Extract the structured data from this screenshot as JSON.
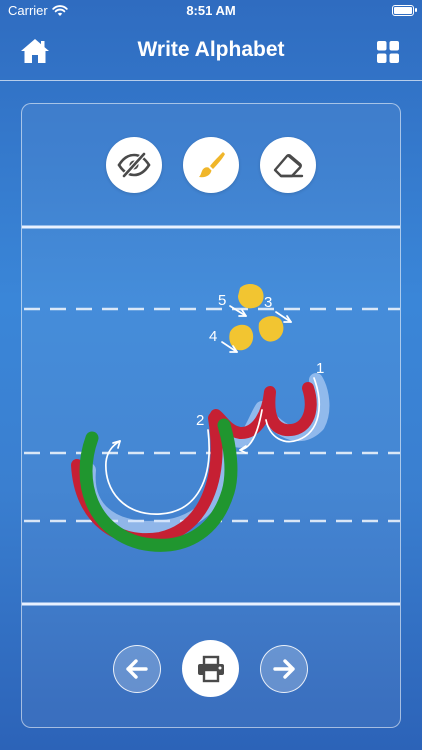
{
  "status_bar": {
    "carrier": "Carrier",
    "time": "8:51 AM"
  },
  "nav": {
    "title": "Write Alphabet",
    "left_icon": "home-icon",
    "right_icon": "grid-icon"
  },
  "tools": [
    {
      "name": "hide-guide",
      "icon": "eye-slash-icon"
    },
    {
      "name": "brush",
      "icon": "paint-brush-icon"
    },
    {
      "name": "eraser",
      "icon": "eraser-icon"
    }
  ],
  "stroke_labels": [
    "1",
    "2",
    "3",
    "4",
    "5"
  ],
  "bottom_controls": {
    "prev_icon": "arrow-left-icon",
    "print_icon": "printer-icon",
    "next_icon": "arrow-right-icon"
  },
  "colors": {
    "background_top": "#2f6cc0",
    "background_mid": "#3a86d8",
    "ink_red": "#c62033",
    "ink_green": "#20962f",
    "ink_yellow": "#f2c531",
    "brush_icon": "#f0b62a",
    "icon_dark": "#4a4a4a"
  }
}
